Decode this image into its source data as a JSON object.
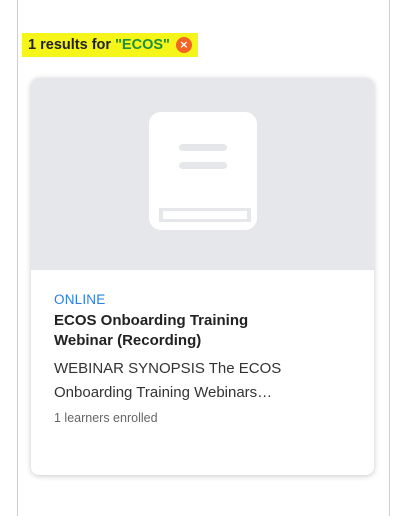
{
  "search": {
    "count": "1",
    "results_label": "results for",
    "query": "\"ECOS\"",
    "clear_icon": "close-circle-icon",
    "highlight_color": "#f5f51a",
    "clear_color": "#f26522"
  },
  "results": [
    {
      "thumbnail_icon": "book-icon",
      "delivery_type": "ONLINE",
      "title_line1": "ECOS Onboarding Training",
      "title_line2": "Webinar (Recording)",
      "synopsis_line1": "WEBINAR SYNOPSIS The ECOS",
      "synopsis_line2": "Onboarding Training Webinars…",
      "enrolled": "1 learners enrolled",
      "accent_color": "#2a7ee6"
    }
  ]
}
